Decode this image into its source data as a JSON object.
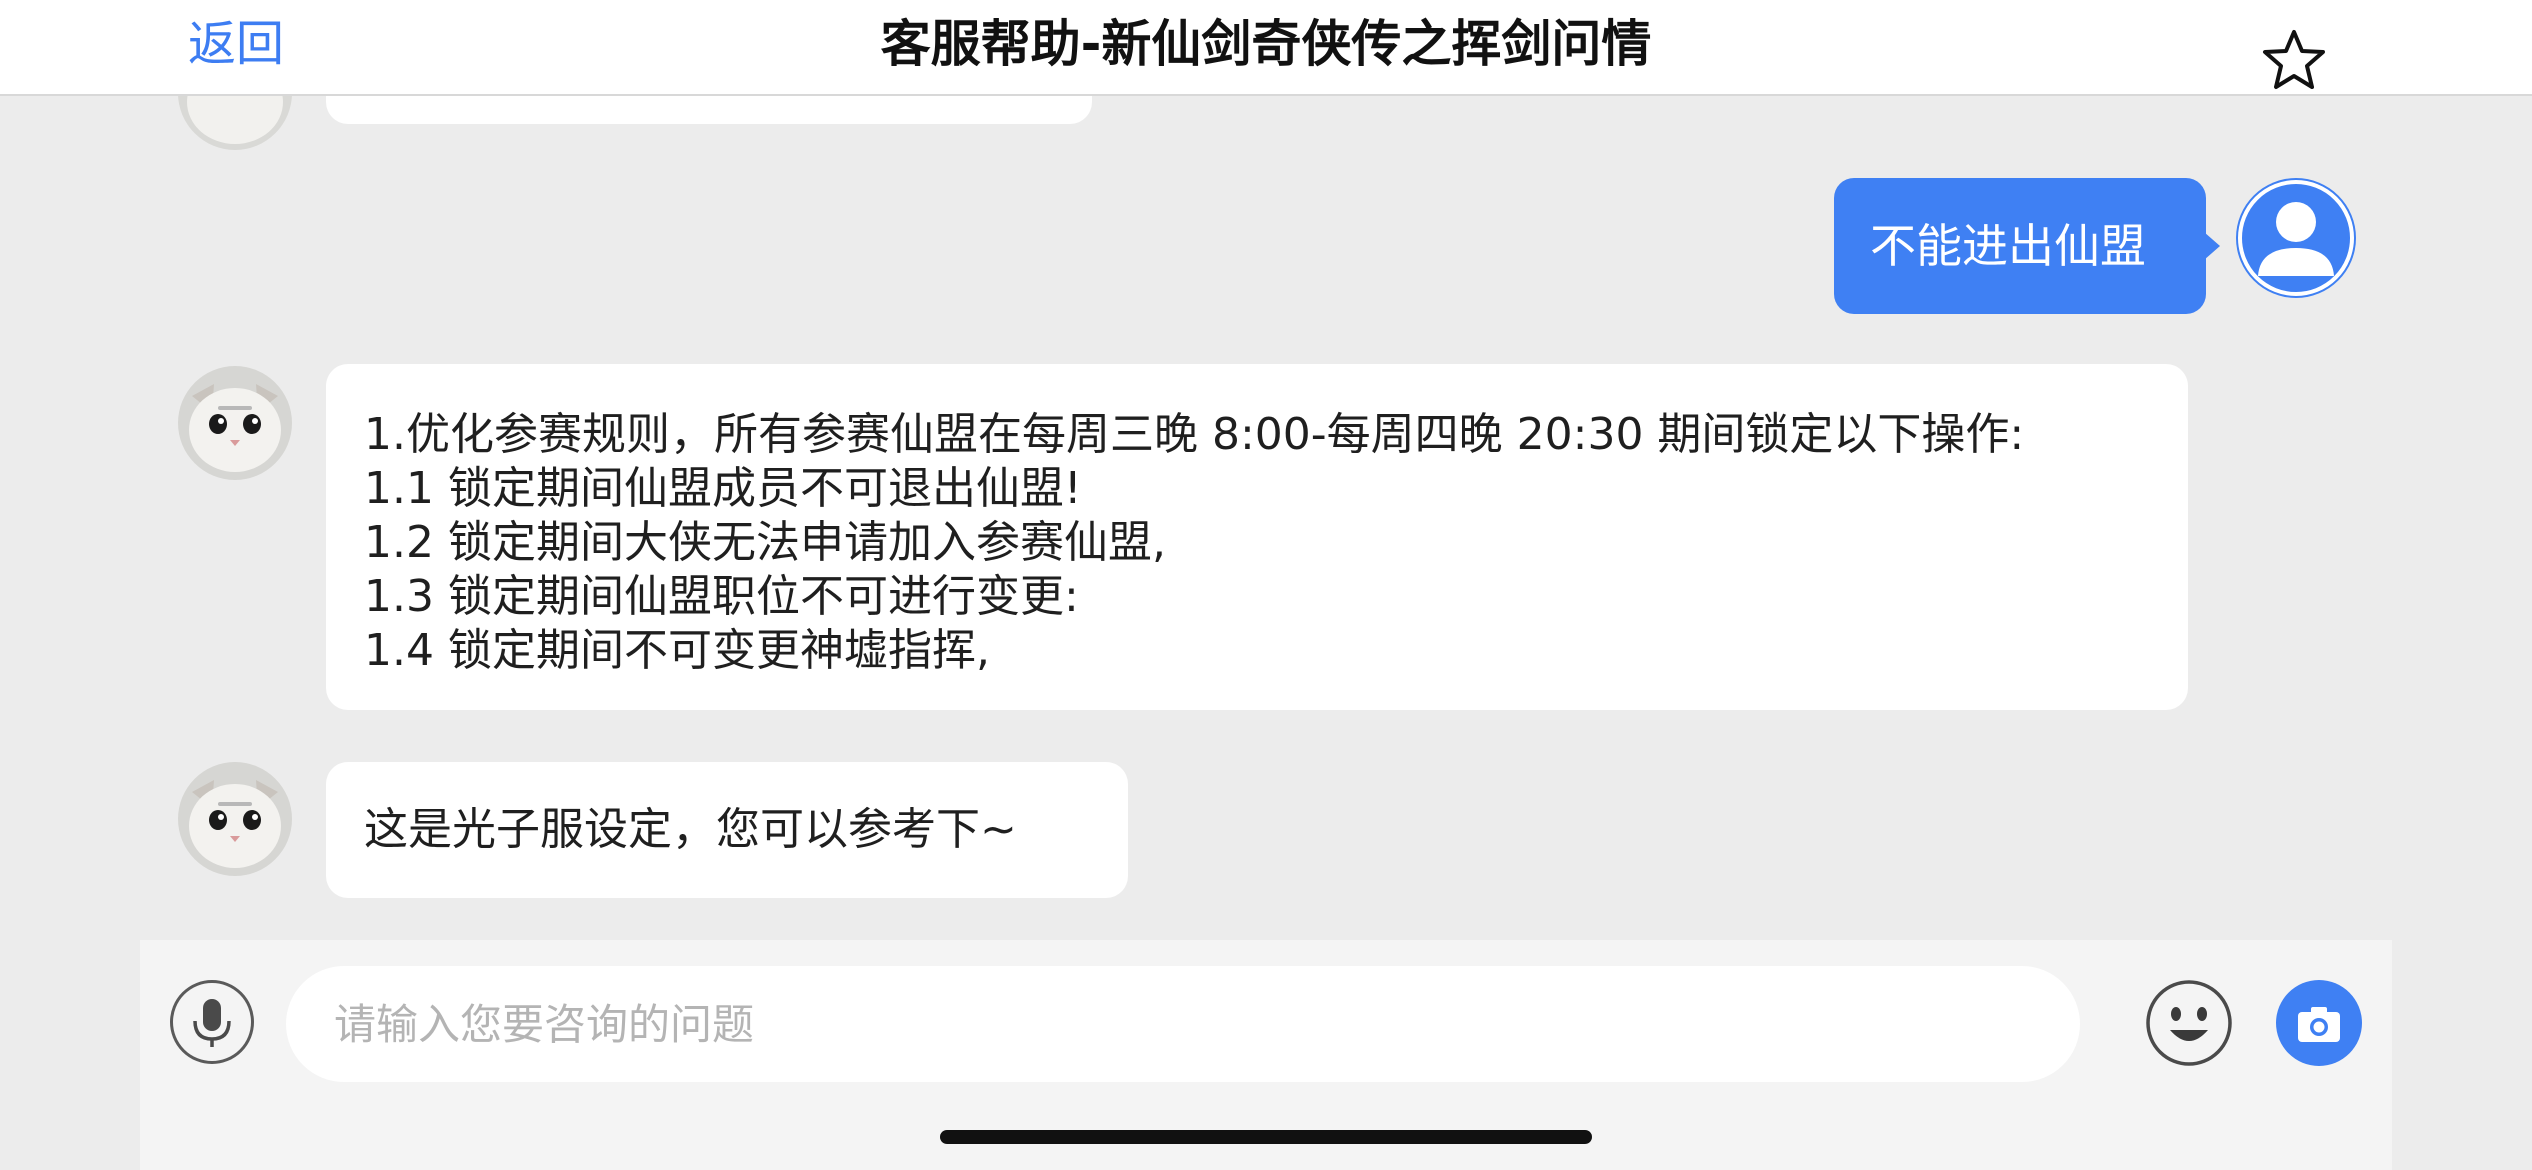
{
  "header": {
    "back_label": "返回",
    "title": "客服帮助-新仙剑奇侠传之挥剑问情",
    "favorite_icon": "star-outline-icon"
  },
  "messages": [
    {
      "sender": "user",
      "text": "不能进出仙盟"
    },
    {
      "sender": "agent",
      "lines": [
        "1.优化参赛规则，所有参赛仙盟在每周三晚 8:00-每周四晚 20:30 期间锁定以下操作:",
        "1.1 锁定期间仙盟成员不可退出仙盟!",
        "1.2 锁定期间大侠无法申请加入参赛仙盟,",
        "1.3 锁定期间仙盟职位不可进行变更:",
        "1.4 锁定期间不可变更神墟指挥,"
      ]
    },
    {
      "sender": "agent",
      "text": "这是光子服设定，您可以参考下~"
    }
  ],
  "input_bar": {
    "placeholder": "请输入您要咨询的问题",
    "value": "",
    "icons": {
      "voice": "microphone-icon",
      "emoji": "smiley-face-icon",
      "photo": "camera-icon"
    }
  },
  "colors": {
    "accent": "#3f80f3",
    "background": "#ececec",
    "bubble": "#ffffff"
  }
}
